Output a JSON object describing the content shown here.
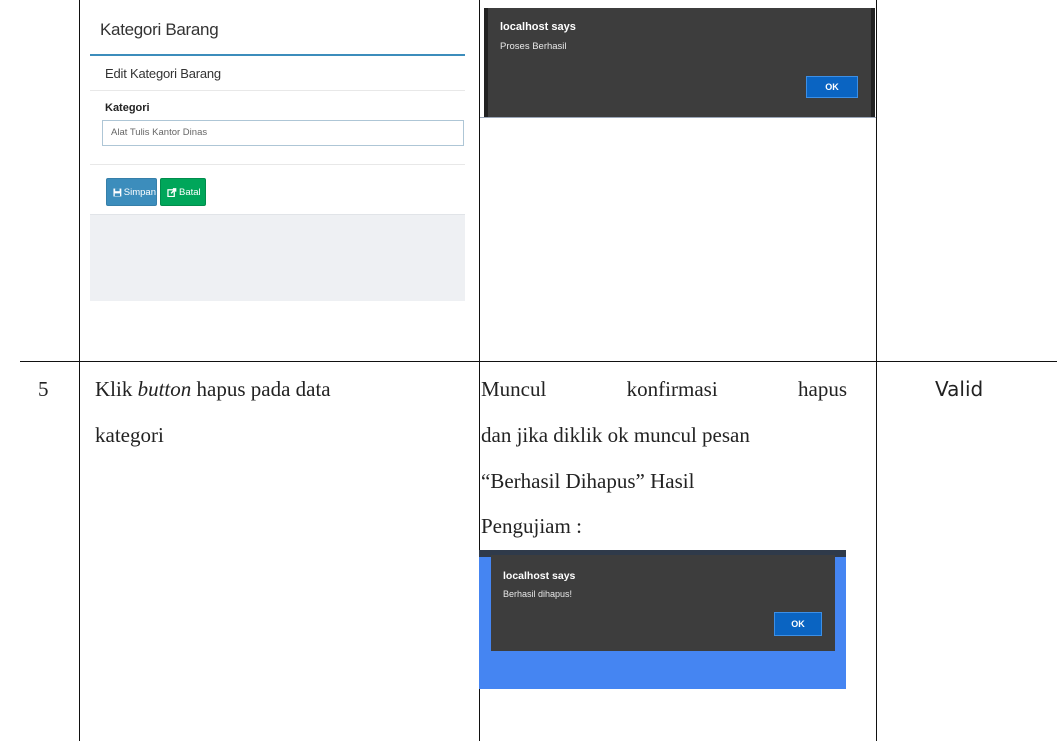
{
  "row_prev": {
    "screenshot_form": {
      "page_title": "Kategori Barang",
      "form_title": "Edit Kategori Barang",
      "field_label": "Kategori",
      "field_value": "Alat Tulis Kantor Dinas",
      "save_button": "Simpan",
      "cancel_button": "Batal",
      "save_icon": "floppy-disk-icon",
      "cancel_icon": "exit-icon"
    },
    "screenshot_dialog": {
      "title": "localhost says",
      "message": "Proses Berhasil",
      "ok_button": "OK"
    }
  },
  "row_5": {
    "number": "5",
    "step_line1_pre": "Klik ",
    "step_line1_em": "button",
    "step_line1_post": " hapus pada data",
    "step_line2": "kategori",
    "expected_line1_a": "Muncul",
    "expected_line1_b": "konfirmasi",
    "expected_line1_c": "hapus",
    "expected_line2": "dan jika diklik ok muncul pesan",
    "expected_line3": "“Berhasil Dihapus” Hasil",
    "expected_line4": "Pengujiam :",
    "result": "Valid",
    "screenshot_dialog": {
      "title": "localhost says",
      "message": "Berhasil dihapus!",
      "ok_button": "OK"
    }
  },
  "colors": {
    "dialog_bg": "#3d3d3d",
    "ok_blue": "#0a64c2",
    "primary": "#3c8dbc",
    "success": "#00a65a",
    "page_blue": "#4585f2"
  }
}
